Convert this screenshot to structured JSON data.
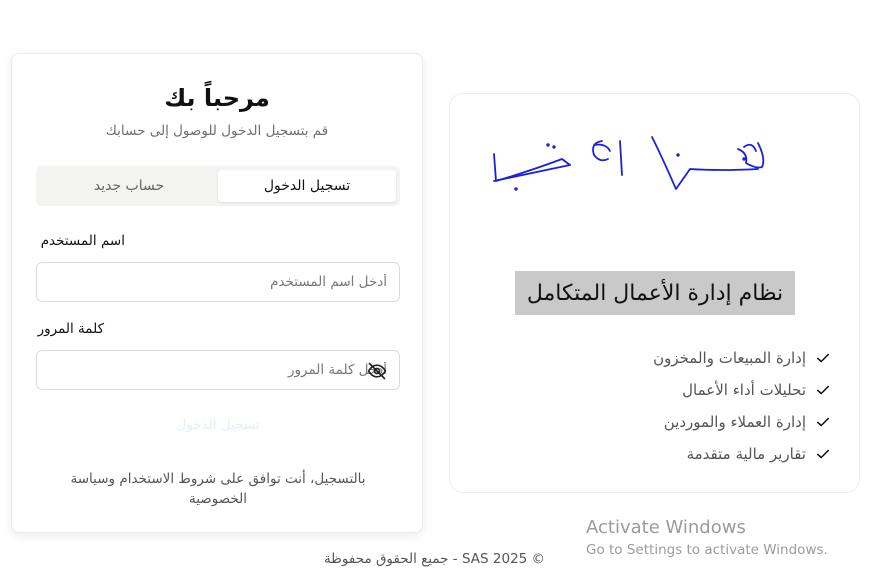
{
  "login": {
    "title": "مرحباً بك",
    "subtitle": "قم بتسجيل الدخول للوصول إلى حسابك",
    "tabs": {
      "login": "تسجيل الدخول",
      "register": "حساب جديد",
      "active": "login"
    },
    "username": {
      "label": "اسم المستخدم",
      "placeholder": "أدخل اسم المستخدم",
      "value": ""
    },
    "password": {
      "label": "كلمة المرور",
      "placeholder": "أدخل كلمة المرور",
      "value": "",
      "toggle_icon": "eye-off-icon"
    },
    "submit_label": "تسجيل الدخول",
    "terms": "بالتسجيل، أنت توافق على شروط الاستخدام وسياسة الخصوصية"
  },
  "feature_panel": {
    "logo": "signature-logo",
    "title": "نظام إدارة الأعمال المتكامل",
    "features": [
      "إدارة المبيعات والمخزون",
      "تحليلات أداء الأعمال",
      "إدارة العملاء والموردين",
      "تقارير مالية متقدمة"
    ],
    "check_icon": "check-icon"
  },
  "activation": {
    "line1": "Activate Windows",
    "line2": "Go to Settings to activate Windows."
  },
  "footer": "© SAS 2025 - جميع الحقوق محفوظة",
  "colors": {
    "signature": "#1a22d8",
    "title_highlight": "#c9c9c9",
    "submit_text": "#e6eef7"
  }
}
